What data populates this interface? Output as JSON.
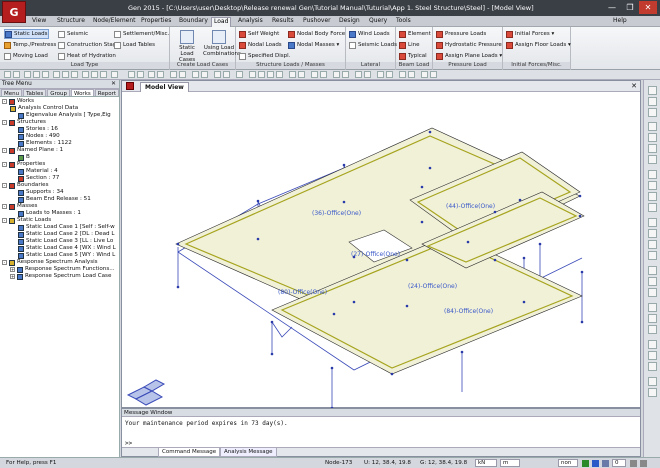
{
  "window": {
    "title": "Gen 2015 - [C:\\Users\\user\\Desktop\\Release renewal Gen\\Tutorial Manual\\Tuturial\\App 1. Steel Structure\\Steel] - [Model View]",
    "logo": "G",
    "help": "Help",
    "minimize": "—",
    "restore": "❐",
    "close": "✕"
  },
  "menu": {
    "tabs": [
      "View",
      "Structure",
      "Node/Element",
      "Properties",
      "Boundary",
      "Load",
      "Analysis",
      "Results",
      "Pushover",
      "Design",
      "Query",
      "Tools"
    ],
    "active": "Load"
  },
  "ribbon": {
    "type": {
      "label": "Load Type",
      "items": [
        "Static Loads",
        "Seismic",
        "Settlement/Misc.",
        "Temp./Prestress",
        "Construction Stage",
        "Load Tables",
        "Moving Load",
        "Heat of Hydration"
      ]
    },
    "cases": {
      "label": "Create Load Cases",
      "items": [
        "Static Load Cases",
        "Using Load Combinations"
      ]
    },
    "structure": {
      "label": "Structure Loads / Masses",
      "items": [
        "Self Weight",
        "Nodal Body Force",
        "Nodal Loads",
        "Nodal Masses ▾",
        "Specified Displ."
      ]
    },
    "lateral": {
      "label": "Lateral",
      "items": [
        "Wind Loads",
        "Seismic Loads"
      ]
    },
    "beam": {
      "label": "Beam Load",
      "items": [
        "Element",
        "Line",
        "Typical"
      ]
    },
    "pressure": {
      "label": "Pressure Load",
      "items": [
        "Pressure Loads",
        "Hydrostatic Pressure",
        "Assign Plane Loads ▾"
      ]
    },
    "initial": {
      "label": "Initial Forces/Misc.",
      "items": [
        "Initial Forces ▾",
        "Assign Floor Loads ▾"
      ]
    }
  },
  "tree": {
    "header": "Tree Menu",
    "tabs": [
      "Menu",
      "Tables",
      "Group",
      "Works",
      "Report"
    ],
    "active_tab": "Works",
    "nodes": [
      "Works",
      "Analysis Control Data",
      "Eigenvalue Analysis [ Type,Eig",
      "Structures",
      "Stories : 16",
      "Nodes : 490",
      "Elements : 1122",
      "Named Plane : 1",
      "B",
      "Properties",
      "Material : 4",
      "Section : 77",
      "Boundaries",
      "Supports : 34",
      "Beam End Release : 51",
      "Masses",
      "Loads to Masses : 1",
      "Static Loads",
      "Static Load Case 1 [Self : Self-w",
      "Static Load Case 2 [DL : Dead L",
      "Static Load Case 3 [LL : Live Lo",
      "Static Load Case 4 [WX : Wind L",
      "Static Load Case 5 [WY : Wind L",
      "Response Spectrum Analysis",
      "Response Spectrum Functions...",
      "Response Spectrum Load Case"
    ]
  },
  "view": {
    "tab": "Model View",
    "labels": [
      "(36)-Office(One)",
      "(44)-Office(One)",
      "(27)-Office(One)",
      "(80)-Office(One)",
      "(24)-Office(One)",
      "(84)-Office(One)"
    ]
  },
  "message": {
    "header": "Message Window",
    "text": "Your maintenance period expires in 73 day(s).",
    "prompt": ">>",
    "tabs": [
      "Command Message",
      "Analysis Message"
    ]
  },
  "status": {
    "help": "For Help, press F1",
    "node": "Node-173",
    "u": "U: 12, 38.4, 19.8",
    "g": "G: 12, 38.4, 19.8",
    "unit1": "kN",
    "unit2": "m",
    "none": "non",
    "zoom": "0"
  }
}
